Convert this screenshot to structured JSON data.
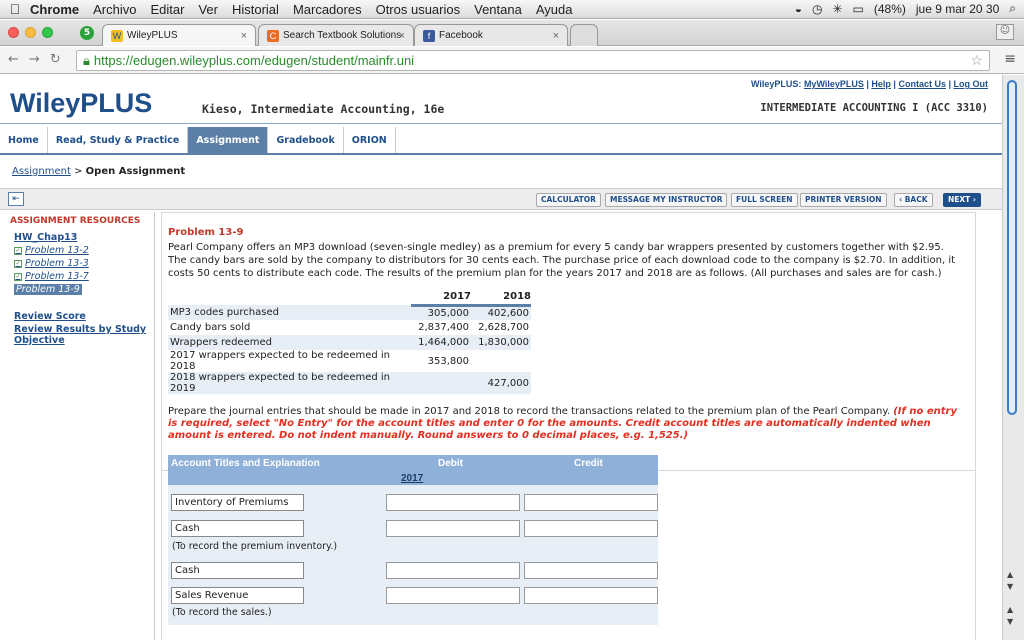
{
  "menubar": {
    "items": [
      "Chrome",
      "Archivo",
      "Editar",
      "Ver",
      "Historial",
      "Marcadores",
      "Otros usuarios",
      "Ventana",
      "Ayuda"
    ],
    "battery": "(48%)",
    "datetime": "jue 9 mar 20 30"
  },
  "tabs": [
    {
      "label": "WileyPLUS",
      "icon": "wiley-favicon"
    },
    {
      "label": "Search Textbook Solutions",
      "icon": "chegg-favicon"
    },
    {
      "label": "Facebook",
      "icon": "facebook-favicon"
    }
  ],
  "address": {
    "url": "https://edugen.wileyplus.com/edugen/student/mainfr.uni"
  },
  "header": {
    "toplinks": [
      "WileyPLUS:",
      "MyWileyPLUS",
      "Help",
      "Contact Us",
      "Log Out"
    ],
    "logo": "WileyPLUS",
    "book": "Kieso, Intermediate Accounting, 16e",
    "course": "INTERMEDIATE ACCOUNTING I (ACC 3310)"
  },
  "nav": {
    "tabs": [
      "Home",
      "Read, Study & Practice",
      "Assignment",
      "Gradebook",
      "ORION"
    ],
    "active": 2
  },
  "breadcrumb": {
    "link": "Assignment",
    "sep": ">",
    "current": "Open Assignment"
  },
  "toolbar": {
    "buttons": [
      "CALCULATOR",
      "MESSAGE MY INSTRUCTOR",
      "FULL SCREEN",
      "PRINTER VERSION",
      "‹ BACK",
      "NEXT ›"
    ]
  },
  "sidebar": {
    "heading": "ASSIGNMENT RESOURCES",
    "hw": "HW_Chap13",
    "problems": [
      "Problem 13-2",
      "Problem 13-3",
      "Problem 13-7",
      "Problem 13-9"
    ],
    "review_score": "Review Score",
    "review_results": "Review Results by Study Objective"
  },
  "problem": {
    "title": "Problem 13-9",
    "description": "Pearl Company offers an MP3 download (seven-single medley) as a premium for every 5 candy bar wrappers presented by customers together with $2.95. The candy bars are sold by the company to distributors for 30 cents each. The purchase price of each download code to the company is $2.70. In addition, it costs 50 cents to distribute each code. The results of the premium plan for the years 2017 and 2018 are as follows. (All purchases and sales are for cash.)",
    "years": [
      "2017",
      "2018"
    ],
    "rows": [
      {
        "label": "MP3 codes purchased",
        "v2017": "305,000",
        "v2018": "402,600"
      },
      {
        "label": "Candy bars sold",
        "v2017": "2,837,400",
        "v2018": "2,628,700"
      },
      {
        "label": "Wrappers redeemed",
        "v2017": "1,464,000",
        "v2018": "1,830,000"
      },
      {
        "label": "2017 wrappers expected to be redeemed in 2018",
        "v2017": "353,800",
        "v2018": ""
      },
      {
        "label": "2018 wrappers expected to be redeemed in 2019",
        "v2017": "",
        "v2018": "427,000"
      }
    ]
  },
  "instructions": {
    "text": "Prepare the journal entries that should be made in 2017 and 2018 to record the transactions related to the premium plan of the Pearl Company.",
    "red": "(If no entry is required, select \"No Entry\" for the account titles and enter 0 for the amounts. Credit account titles are automatically indented when amount is entered. Do not indent manually. Round answers to 0 decimal places, e.g. 1,525.)"
  },
  "journal": {
    "headers": {
      "account": "Account Titles and Explanation",
      "debit": "Debit",
      "credit": "Credit",
      "year": "2017"
    },
    "entries": [
      {
        "account": "Inventory of Premiums"
      },
      {
        "account": "Cash",
        "memo": "(To record the premium inventory.)"
      },
      {
        "account": "Cash"
      },
      {
        "account": "Sales Revenue",
        "memo": "(To record the sales.)"
      }
    ]
  }
}
